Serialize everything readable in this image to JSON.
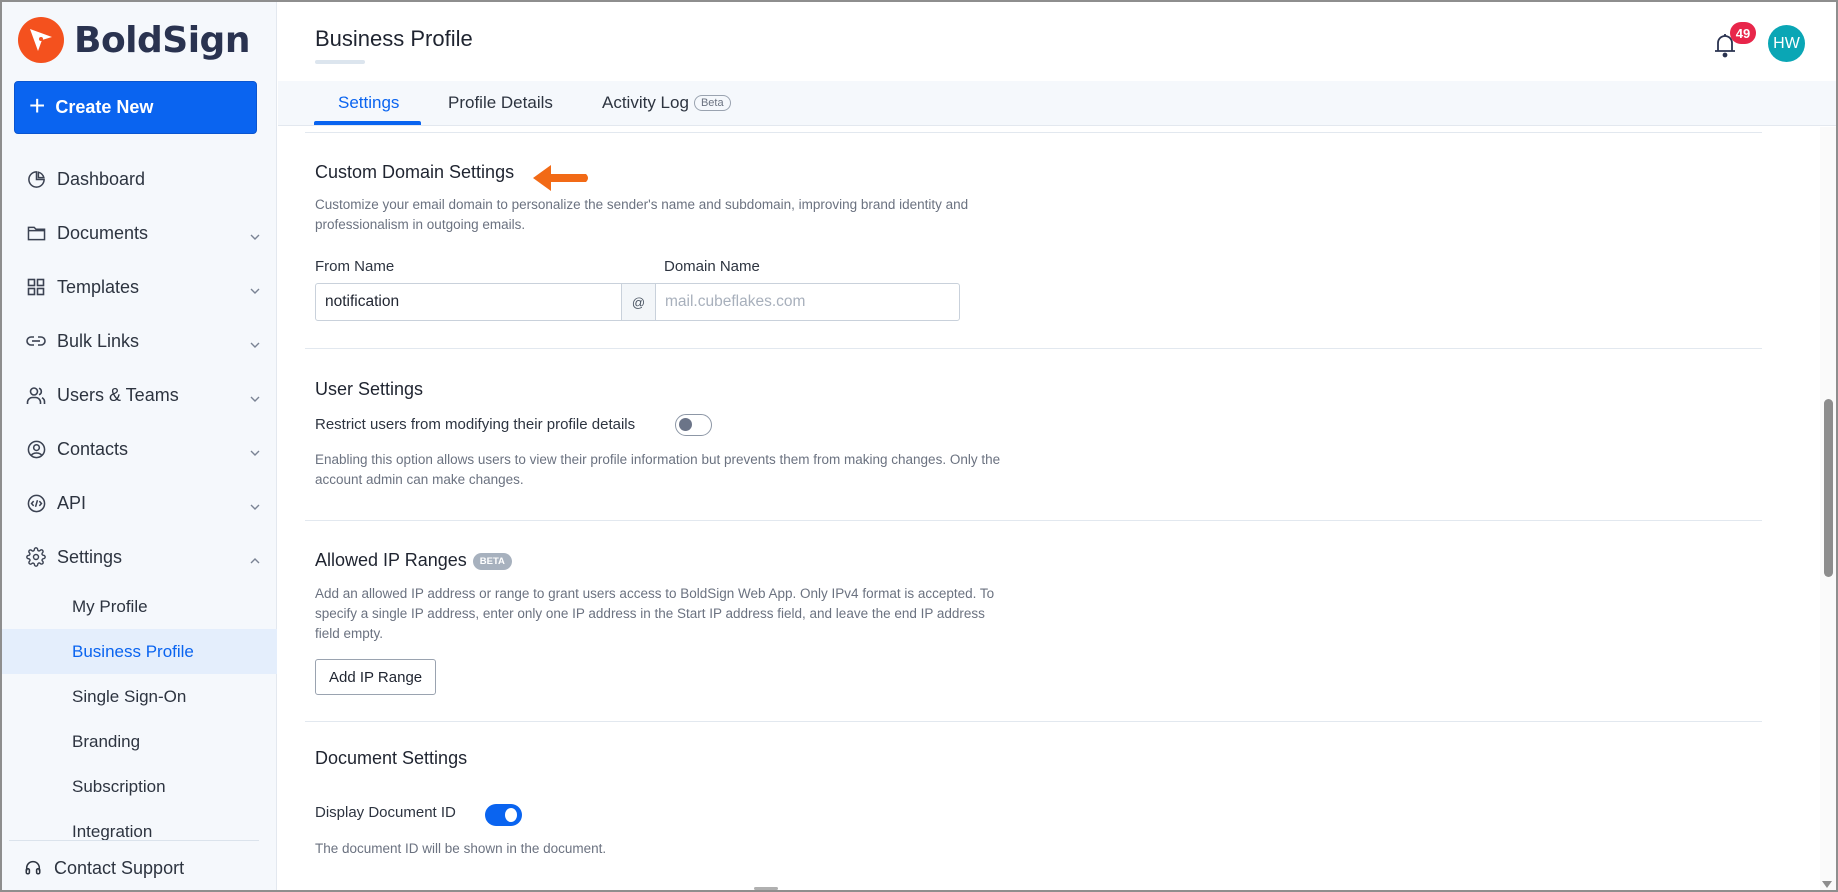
{
  "app": {
    "name": "BoldSign",
    "brand_color": "#f4511e",
    "accent_color": "#0a64f0"
  },
  "sidebar": {
    "create_label": "Create New",
    "items": [
      {
        "label": "Dashboard",
        "icon": "pie-chart-icon",
        "expandable": false
      },
      {
        "label": "Documents",
        "icon": "folder-icon",
        "expandable": true,
        "expanded": false
      },
      {
        "label": "Templates",
        "icon": "grid-icon",
        "expandable": true,
        "expanded": false
      },
      {
        "label": "Bulk Links",
        "icon": "link-icon",
        "expandable": true,
        "expanded": false
      },
      {
        "label": "Users & Teams",
        "icon": "users-icon",
        "expandable": true,
        "expanded": false
      },
      {
        "label": "Contacts",
        "icon": "contact-icon",
        "expandable": true,
        "expanded": false
      },
      {
        "label": "API",
        "icon": "code-icon",
        "expandable": true,
        "expanded": false
      },
      {
        "label": "Settings",
        "icon": "gear-icon",
        "expandable": true,
        "expanded": true
      }
    ],
    "settings_sub": [
      {
        "label": "My Profile",
        "active": false
      },
      {
        "label": "Business Profile",
        "active": true
      },
      {
        "label": "Single Sign-On",
        "active": false
      },
      {
        "label": "Branding",
        "active": false
      },
      {
        "label": "Subscription",
        "active": false
      },
      {
        "label": "Integration",
        "active": false
      }
    ],
    "support_label": "Contact Support"
  },
  "header": {
    "title": "Business Profile",
    "notification_count": "49",
    "avatar_initials": "HW"
  },
  "tabs": [
    {
      "label": "Settings",
      "active": true
    },
    {
      "label": "Profile Details",
      "active": false
    },
    {
      "label": "Activity Log",
      "active": false,
      "pill": "Beta"
    }
  ],
  "sections": {
    "custom_domain": {
      "title": "Custom Domain Settings",
      "description": "Customize your email domain to personalize the sender's name and subdomain, improving brand identity and professionalism in outgoing emails.",
      "from_name_label": "From Name",
      "domain_name_label": "Domain Name",
      "from_name_value": "notification",
      "at_symbol": "@",
      "domain_placeholder": "mail.cubeflakes.com",
      "domain_value": ""
    },
    "user_settings": {
      "title": "User Settings",
      "toggle_label": "Restrict users from modifying their profile details",
      "toggle_on": false,
      "description": "Enabling this option allows users to view their profile information but prevents them from making changes. Only the account admin can make changes."
    },
    "allowed_ip": {
      "title": "Allowed IP Ranges",
      "badge": "BETA",
      "description": "Add an allowed IP address or range to grant users access to BoldSign Web App. Only IPv4 format is accepted. To specify a single IP address, enter only one IP address in the Start IP address field, and leave the end IP address field empty.",
      "button_label": "Add IP Range"
    },
    "document_settings": {
      "title": "Document Settings",
      "toggle_label": "Display Document ID",
      "toggle_on": true,
      "description": "The document ID will be shown in the document."
    }
  }
}
